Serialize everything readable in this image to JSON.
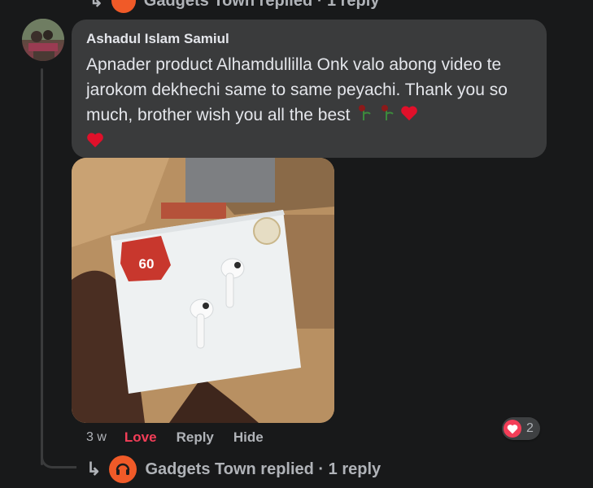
{
  "top_replied": {
    "text": "Gadgets Town replied · 1 reply"
  },
  "comment": {
    "author": "Ashadul Islam Samiul",
    "text": "Apnader product Alhamdullilla Onk valo abong video te jarokom dekhechi same to same peyachi. Thank you so much, brother wish you all the best",
    "photo_label": "60",
    "time": "3 w",
    "love_label": "Love",
    "reply_label": "Reply",
    "hide_label": "Hide",
    "reaction_count": "2"
  },
  "reply_summary": {
    "text": "Gadgets Town replied · 1 reply"
  },
  "colors": {
    "background": "#18191a",
    "bubble": "#3a3b3c",
    "love": "#f33e58",
    "muted": "#b0b3b8"
  }
}
